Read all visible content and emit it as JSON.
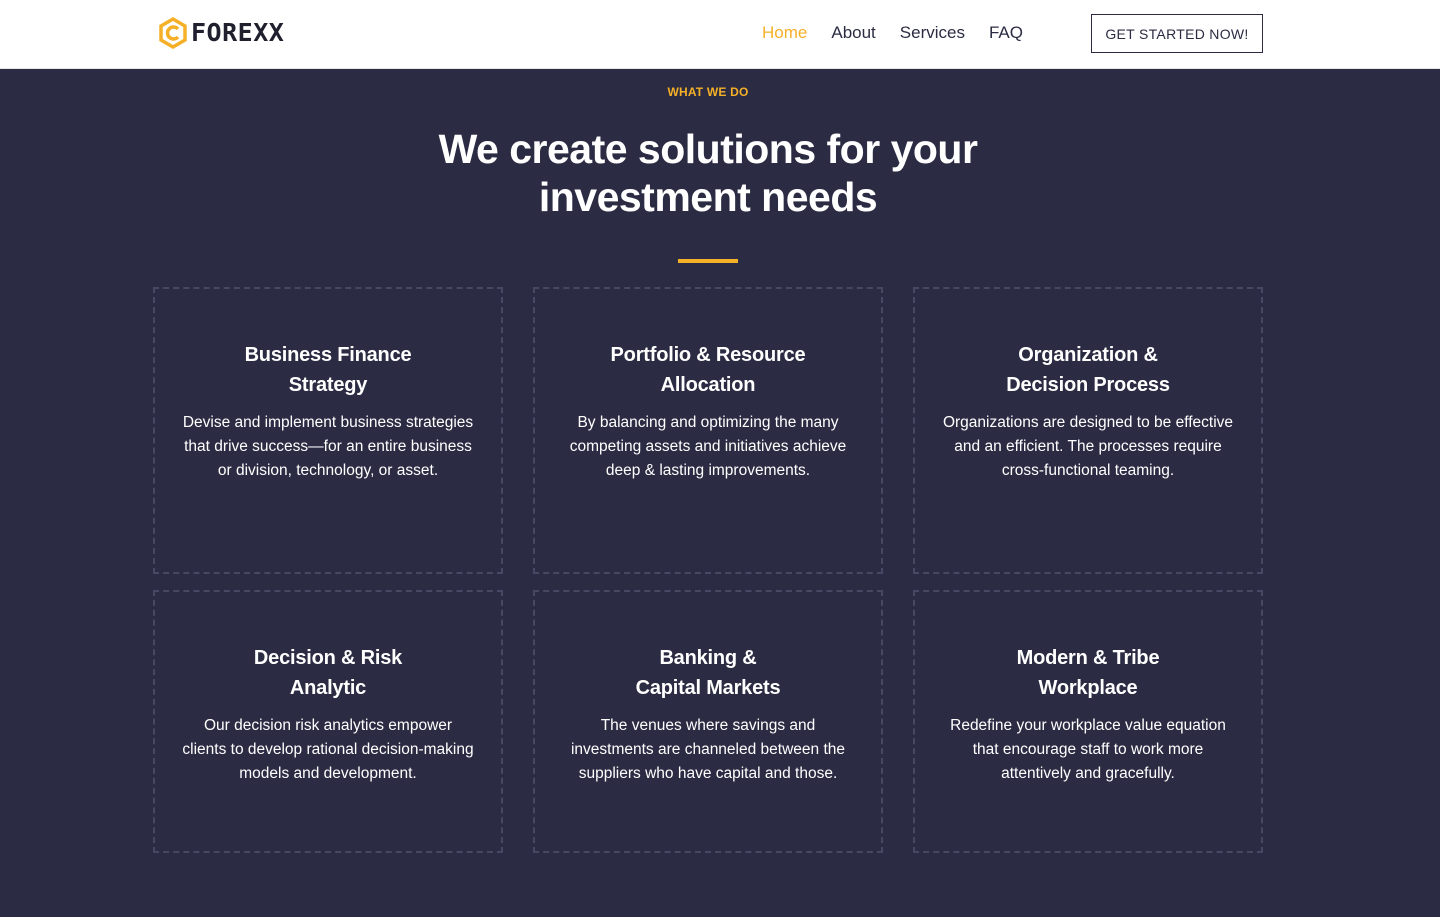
{
  "brand": {
    "name": "FOREXX",
    "accent": "#f6b027",
    "dark": "#2b2c43"
  },
  "nav": {
    "items": [
      {
        "label": "Home",
        "active": true
      },
      {
        "label": "About",
        "active": false
      },
      {
        "label": "Services",
        "active": false
      },
      {
        "label": "FAQ",
        "active": false
      }
    ],
    "cta_label": "GET STARTED NOW!"
  },
  "section": {
    "eyebrow": "WHAT WE DO",
    "heading_line1": "We create solutions for your",
    "heading_line2": "investment needs"
  },
  "cards": [
    {
      "title_line1": "Business Finance",
      "title_line2": "Strategy",
      "text": "Devise and implement business strategies that drive success—for an entire business or division, technology, or asset."
    },
    {
      "title_line1": "Portfolio & Resource",
      "title_line2": "Allocation",
      "text": "By balancing and optimizing the many competing assets and initiatives achieve deep & lasting improvements."
    },
    {
      "title_line1": "Organization &",
      "title_line2": "Decision Process",
      "text": "Organizations are designed to be effective and an efficient. The processes require cross-functional teaming."
    },
    {
      "title_line1": "Decision & Risk",
      "title_line2": "Analytic",
      "text": "Our decision risk analytics empower clients to develop rational decision-making models and development."
    },
    {
      "title_line1": "Banking &",
      "title_line2": "Capital Markets",
      "text": "The venues where savings and investments are channeled between the suppliers who have capital and those."
    },
    {
      "title_line1": "Modern & Tribe",
      "title_line2": "Workplace",
      "text": "Redefine your workplace value equation that encourage staff to work more attentively and gracefully."
    }
  ]
}
